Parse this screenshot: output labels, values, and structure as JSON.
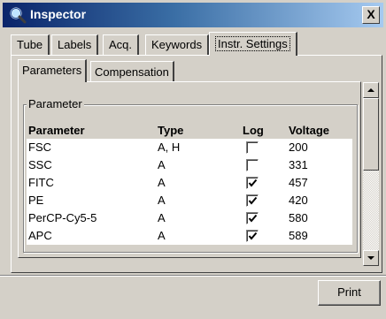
{
  "window": {
    "title": "Inspector",
    "close_label": "X",
    "titlebar_colors": [
      "#0a246a",
      "#3a6ea5",
      "#a6caf0"
    ]
  },
  "tabs": [
    {
      "label": "Tube",
      "active": false
    },
    {
      "label": "Labels",
      "active": false
    },
    {
      "label": "Acq.",
      "active": false
    },
    {
      "label": "Keywords",
      "active": false
    },
    {
      "label": "Instr. Settings",
      "active": true
    }
  ],
  "subtabs": [
    {
      "label": "Parameters",
      "active": true
    },
    {
      "label": "Compensation",
      "active": false
    }
  ],
  "group": {
    "legend": "Parameter"
  },
  "table": {
    "headers": {
      "parameter": "Parameter",
      "type": "Type",
      "log": "Log",
      "voltage": "Voltage"
    },
    "rows": [
      {
        "parameter": "FSC",
        "type": "A, H",
        "log": false,
        "voltage": "200"
      },
      {
        "parameter": "SSC",
        "type": "A",
        "log": false,
        "voltage": "331"
      },
      {
        "parameter": "FITC",
        "type": "A",
        "log": true,
        "voltage": "457"
      },
      {
        "parameter": "PE",
        "type": "A",
        "log": true,
        "voltage": "420"
      },
      {
        "parameter": "PerCP-Cy5-5",
        "type": "A",
        "log": true,
        "voltage": "580"
      },
      {
        "parameter": "APC",
        "type": "A",
        "log": true,
        "voltage": "589"
      }
    ]
  },
  "footer": {
    "print_label": "Print"
  },
  "icons": {
    "app": "magnifier-icon",
    "scroll_up": "arrow-up-icon",
    "scroll_down": "arrow-down-icon",
    "check": "checkmark-icon"
  }
}
